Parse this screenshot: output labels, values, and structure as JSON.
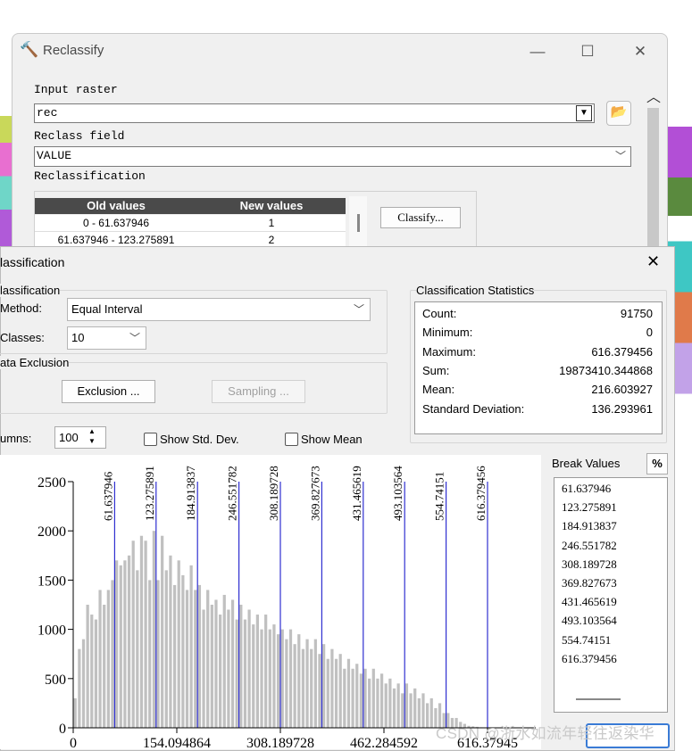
{
  "reclassify": {
    "title": "Reclassify",
    "input_raster_label": "Input raster",
    "input_raster_value": "rec",
    "reclass_field_label": "Reclass field",
    "reclass_field_value": "VALUE",
    "reclassification_label": "Reclassification",
    "classify_button": "Classify...",
    "table_headers": [
      "Old values",
      "New values"
    ],
    "rows": [
      {
        "old": "0 - 61.637946",
        "new": "1"
      },
      {
        "old": "61.637946 - 123.275891",
        "new": "2"
      }
    ]
  },
  "classification": {
    "title": "lassification",
    "group_classification": "lassification",
    "method_label": "Method:",
    "method_value": "Equal Interval",
    "classes_label": "Classes:",
    "classes_value": "10",
    "group_exclusion": "ata Exclusion",
    "exclusion_button": "Exclusion ...",
    "sampling_button": "Sampling ...",
    "columns_label": "umns:",
    "columns_value": "100",
    "show_std_dev": "Show Std. Dev.",
    "show_mean": "Show Mean",
    "stats_title": "Classification Statistics",
    "stats": [
      {
        "k": "Count:",
        "v": "91750"
      },
      {
        "k": "Minimum:",
        "v": "0"
      },
      {
        "k": "Maximum:",
        "v": "616.379456"
      },
      {
        "k": "Sum:",
        "v": "19873410.344868"
      },
      {
        "k": "Mean:",
        "v": "216.603927"
      },
      {
        "k": "Standard Deviation:",
        "v": "136.293961"
      }
    ],
    "break_values_label": "Break Values",
    "percent_button": "%",
    "break_values": [
      "61.637946",
      "123.275891",
      "184.913837",
      "246.551782",
      "308.189728",
      "369.827673",
      "431.465619",
      "493.103564",
      "554.74151",
      "616.379456"
    ]
  },
  "chart_data": {
    "type": "bar",
    "ylim": [
      0,
      2500
    ],
    "xlim": [
      0,
      616.379456
    ],
    "y_ticks": [
      "2500",
      "2000",
      "1500",
      "1000",
      "500",
      "0"
    ],
    "x_ticks": [
      "0",
      "154.094864",
      "308.189728",
      "462.284592",
      "616.37945"
    ],
    "breaks": [
      61.637946,
      123.275891,
      184.913837,
      246.551782,
      308.189728,
      369.827673,
      431.465619,
      493.103564,
      554.74151,
      616.379456
    ],
    "break_labels": [
      "61.637946",
      "123.275891",
      "184.913837",
      "246.551782",
      "308.189728",
      "369.827673",
      "431.465619",
      "493.103564",
      "554.74151",
      "616.379456"
    ],
    "values": [
      300,
      800,
      900,
      1250,
      1150,
      1100,
      1400,
      1250,
      1400,
      1500,
      1700,
      1650,
      1700,
      1750,
      1900,
      1600,
      1950,
      1900,
      1500,
      2000,
      1500,
      1950,
      1600,
      1750,
      1450,
      1700,
      1550,
      1400,
      1650,
      1400,
      1450,
      1200,
      1400,
      1250,
      1300,
      1150,
      1350,
      1200,
      1300,
      1100,
      1250,
      1100,
      1200,
      1050,
      1150,
      1000,
      1150,
      1000,
      1050,
      950,
      1000,
      900,
      1000,
      850,
      950,
      800,
      900,
      800,
      900,
      750,
      850,
      700,
      800,
      700,
      750,
      600,
      700,
      600,
      650,
      550,
      600,
      500,
      600,
      500,
      550,
      450,
      500,
      400,
      450,
      350,
      450,
      350,
      400,
      300,
      350,
      250,
      300,
      200,
      250,
      150,
      150,
      100,
      100,
      60,
      40,
      20,
      15,
      10,
      5,
      2
    ],
    "colors": {
      "bar": "#c0c0c0",
      "break_line": "#2f2fd0"
    }
  },
  "watermark": "CSDN @浙水如流年轻往返染华"
}
